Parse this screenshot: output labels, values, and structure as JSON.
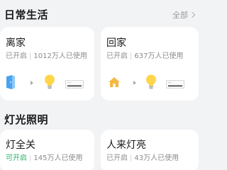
{
  "sections": {
    "daily": {
      "title": "日常生活",
      "see_all": "全部"
    },
    "lighting": {
      "title": "灯光照明"
    }
  },
  "cards": [
    {
      "title": "离家",
      "status": "已开启",
      "users": "1012万人已使用",
      "flow_icons": [
        "door-sensor-icon",
        "arrow-icon",
        "lightbulb-icon",
        "air-conditioner-icon"
      ]
    },
    {
      "title": "回家",
      "status": "已开启",
      "users": "637万人已使用",
      "flow_icons": [
        "home-icon",
        "arrow-icon",
        "lightbulb-icon",
        "air-conditioner-icon"
      ]
    },
    {
      "title": "灯全关",
      "status": "可开启",
      "users": "145万人已使用"
    },
    {
      "title": "人来灯亮",
      "status": "已开启",
      "users": "43万人已使用"
    }
  ],
  "colors": {
    "background": "#f2f3f5",
    "card": "#ffffff",
    "available_status": "#29b36a",
    "bulb": "#ffd54a",
    "door": "#4aa3f0",
    "home": "#f5b942"
  }
}
